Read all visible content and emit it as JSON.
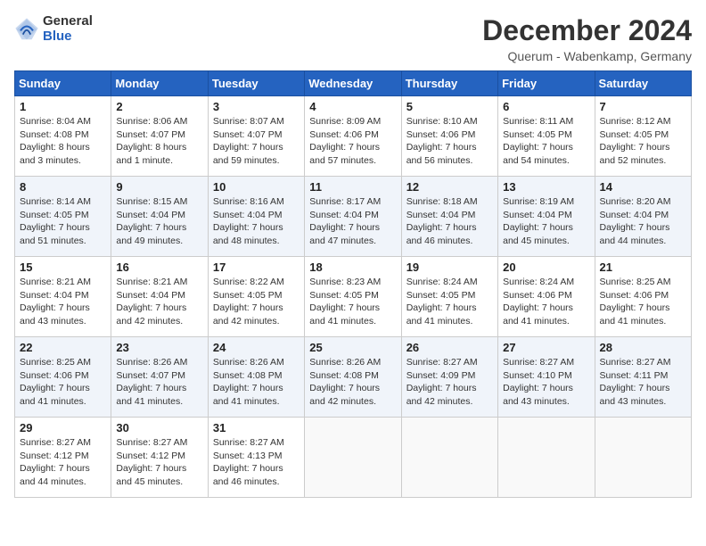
{
  "header": {
    "logo_general": "General",
    "logo_blue": "Blue",
    "month_title": "December 2024",
    "location": "Querum -  Wabenkamp, Germany"
  },
  "days_of_week": [
    "Sunday",
    "Monday",
    "Tuesday",
    "Wednesday",
    "Thursday",
    "Friday",
    "Saturday"
  ],
  "weeks": [
    [
      {
        "day": "1",
        "info": "Sunrise: 8:04 AM\nSunset: 4:08 PM\nDaylight: 8 hours\nand 3 minutes."
      },
      {
        "day": "2",
        "info": "Sunrise: 8:06 AM\nSunset: 4:07 PM\nDaylight: 8 hours\nand 1 minute."
      },
      {
        "day": "3",
        "info": "Sunrise: 8:07 AM\nSunset: 4:07 PM\nDaylight: 7 hours\nand 59 minutes."
      },
      {
        "day": "4",
        "info": "Sunrise: 8:09 AM\nSunset: 4:06 PM\nDaylight: 7 hours\nand 57 minutes."
      },
      {
        "day": "5",
        "info": "Sunrise: 8:10 AM\nSunset: 4:06 PM\nDaylight: 7 hours\nand 56 minutes."
      },
      {
        "day": "6",
        "info": "Sunrise: 8:11 AM\nSunset: 4:05 PM\nDaylight: 7 hours\nand 54 minutes."
      },
      {
        "day": "7",
        "info": "Sunrise: 8:12 AM\nSunset: 4:05 PM\nDaylight: 7 hours\nand 52 minutes."
      }
    ],
    [
      {
        "day": "8",
        "info": "Sunrise: 8:14 AM\nSunset: 4:05 PM\nDaylight: 7 hours\nand 51 minutes."
      },
      {
        "day": "9",
        "info": "Sunrise: 8:15 AM\nSunset: 4:04 PM\nDaylight: 7 hours\nand 49 minutes."
      },
      {
        "day": "10",
        "info": "Sunrise: 8:16 AM\nSunset: 4:04 PM\nDaylight: 7 hours\nand 48 minutes."
      },
      {
        "day": "11",
        "info": "Sunrise: 8:17 AM\nSunset: 4:04 PM\nDaylight: 7 hours\nand 47 minutes."
      },
      {
        "day": "12",
        "info": "Sunrise: 8:18 AM\nSunset: 4:04 PM\nDaylight: 7 hours\nand 46 minutes."
      },
      {
        "day": "13",
        "info": "Sunrise: 8:19 AM\nSunset: 4:04 PM\nDaylight: 7 hours\nand 45 minutes."
      },
      {
        "day": "14",
        "info": "Sunrise: 8:20 AM\nSunset: 4:04 PM\nDaylight: 7 hours\nand 44 minutes."
      }
    ],
    [
      {
        "day": "15",
        "info": "Sunrise: 8:21 AM\nSunset: 4:04 PM\nDaylight: 7 hours\nand 43 minutes."
      },
      {
        "day": "16",
        "info": "Sunrise: 8:21 AM\nSunset: 4:04 PM\nDaylight: 7 hours\nand 42 minutes."
      },
      {
        "day": "17",
        "info": "Sunrise: 8:22 AM\nSunset: 4:05 PM\nDaylight: 7 hours\nand 42 minutes."
      },
      {
        "day": "18",
        "info": "Sunrise: 8:23 AM\nSunset: 4:05 PM\nDaylight: 7 hours\nand 41 minutes."
      },
      {
        "day": "19",
        "info": "Sunrise: 8:24 AM\nSunset: 4:05 PM\nDaylight: 7 hours\nand 41 minutes."
      },
      {
        "day": "20",
        "info": "Sunrise: 8:24 AM\nSunset: 4:06 PM\nDaylight: 7 hours\nand 41 minutes."
      },
      {
        "day": "21",
        "info": "Sunrise: 8:25 AM\nSunset: 4:06 PM\nDaylight: 7 hours\nand 41 minutes."
      }
    ],
    [
      {
        "day": "22",
        "info": "Sunrise: 8:25 AM\nSunset: 4:06 PM\nDaylight: 7 hours\nand 41 minutes."
      },
      {
        "day": "23",
        "info": "Sunrise: 8:26 AM\nSunset: 4:07 PM\nDaylight: 7 hours\nand 41 minutes."
      },
      {
        "day": "24",
        "info": "Sunrise: 8:26 AM\nSunset: 4:08 PM\nDaylight: 7 hours\nand 41 minutes."
      },
      {
        "day": "25",
        "info": "Sunrise: 8:26 AM\nSunset: 4:08 PM\nDaylight: 7 hours\nand 42 minutes."
      },
      {
        "day": "26",
        "info": "Sunrise: 8:27 AM\nSunset: 4:09 PM\nDaylight: 7 hours\nand 42 minutes."
      },
      {
        "day": "27",
        "info": "Sunrise: 8:27 AM\nSunset: 4:10 PM\nDaylight: 7 hours\nand 43 minutes."
      },
      {
        "day": "28",
        "info": "Sunrise: 8:27 AM\nSunset: 4:11 PM\nDaylight: 7 hours\nand 43 minutes."
      }
    ],
    [
      {
        "day": "29",
        "info": "Sunrise: 8:27 AM\nSunset: 4:12 PM\nDaylight: 7 hours\nand 44 minutes."
      },
      {
        "day": "30",
        "info": "Sunrise: 8:27 AM\nSunset: 4:12 PM\nDaylight: 7 hours\nand 45 minutes."
      },
      {
        "day": "31",
        "info": "Sunrise: 8:27 AM\nSunset: 4:13 PM\nDaylight: 7 hours\nand 46 minutes."
      },
      {
        "day": "",
        "info": ""
      },
      {
        "day": "",
        "info": ""
      },
      {
        "day": "",
        "info": ""
      },
      {
        "day": "",
        "info": ""
      }
    ]
  ]
}
